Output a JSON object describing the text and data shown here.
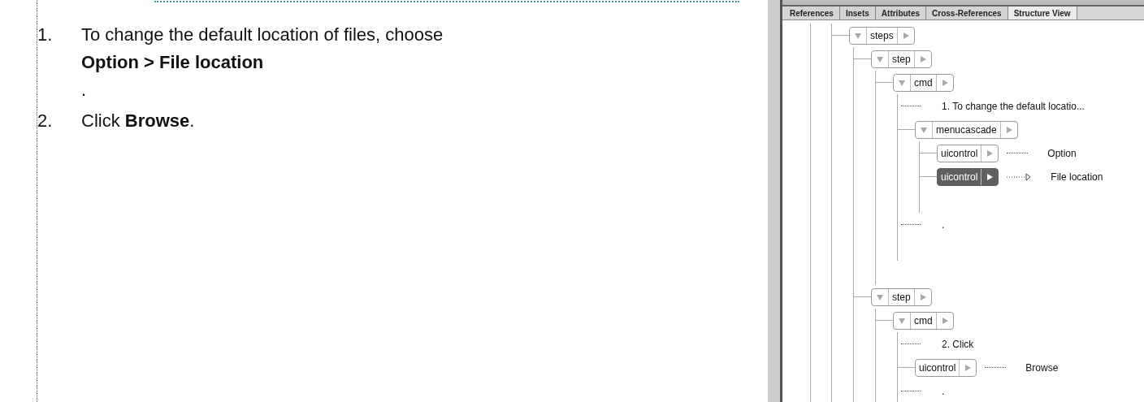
{
  "document": {
    "items": [
      {
        "number": "1.",
        "lines": [
          "To change the default location of files, choose",
          "**Option > File location**",
          "."
        ]
      },
      {
        "number": "2.",
        "lines": [
          "Click **Browse**."
        ]
      }
    ]
  },
  "panel": {
    "tabs": [
      {
        "label": "References",
        "selected": false
      },
      {
        "label": "Insets",
        "selected": false
      },
      {
        "label": "Attributes",
        "selected": false
      },
      {
        "label": "Cross-References",
        "selected": false
      },
      {
        "label": "Structure View",
        "selected": true
      }
    ],
    "tree": [
      {
        "kind": "element",
        "tag": "steps",
        "expanded": true,
        "selected": false,
        "children": [
          {
            "kind": "element",
            "tag": "step",
            "expanded": true,
            "selected": false,
            "children": [
              {
                "kind": "element",
                "tag": "cmd",
                "expanded": true,
                "selected": false,
                "children": [
                  {
                    "kind": "text",
                    "text": "1. To change the default locatio..."
                  },
                  {
                    "kind": "element",
                    "tag": "menucascade",
                    "expanded": true,
                    "selected": false,
                    "children": [
                      {
                        "kind": "element",
                        "tag": "uicontrol",
                        "selected": false,
                        "content": "Option"
                      },
                      {
                        "kind": "element",
                        "tag": "uicontrol",
                        "selected": true,
                        "content": "File location"
                      }
                    ]
                  },
                  {
                    "kind": "text",
                    "text": "."
                  }
                ]
              }
            ]
          },
          {
            "kind": "element",
            "tag": "step",
            "expanded": true,
            "selected": false,
            "children": [
              {
                "kind": "element",
                "tag": "cmd",
                "expanded": true,
                "selected": false,
                "children": [
                  {
                    "kind": "text",
                    "text": "2. Click"
                  },
                  {
                    "kind": "element",
                    "tag": "uicontrol",
                    "selected": false,
                    "content": "Browse"
                  },
                  {
                    "kind": "text",
                    "text": "."
                  }
                ]
              }
            ]
          }
        ]
      }
    ]
  }
}
